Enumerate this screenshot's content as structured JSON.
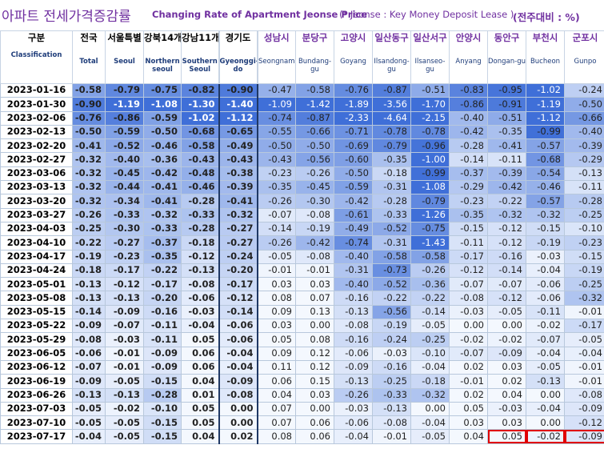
{
  "title": {
    "korean": "아파트 전세가격증감률",
    "english": "Changing Rate of Apartment Jeonse Price",
    "note": "(* Jeonse : Key Money Deposit Lease )",
    "unit": "(전주대비 : %)"
  },
  "columns": [
    {
      "kr": "구분",
      "en": "Classification"
    },
    {
      "kr": "전국",
      "en": "Total"
    },
    {
      "kr": "서울특별",
      "en": "Seoul"
    },
    {
      "kr": "강북14개",
      "en": "Northern seoul"
    },
    {
      "kr": "강남11개",
      "en": "Southern Seoul"
    },
    {
      "kr": "경기도",
      "en": "Gyeonggi-do"
    },
    {
      "kr": "성남시",
      "en": "Seongnam"
    },
    {
      "kr": "분당구",
      "en": "Bundang-gu"
    },
    {
      "kr": "고양시",
      "en": "Goyang"
    },
    {
      "kr": "일산동구",
      "en": "Ilsandong-gu"
    },
    {
      "kr": "일산서구",
      "en": "Ilsanseo-gu"
    },
    {
      "kr": "안양시",
      "en": "Anyang"
    },
    {
      "kr": "동안구",
      "en": "Dongan-gu"
    },
    {
      "kr": "부천시",
      "en": "Bucheon"
    },
    {
      "kr": "군포시",
      "en": "Gunpo"
    }
  ],
  "rows": [
    {
      "date": "2023-01-16",
      "values": [
        "-0.58",
        "-0.79",
        "-0.75",
        "-0.82",
        "-0.90",
        "-0.47",
        "-0.58",
        "-0.76",
        "-0.87",
        "-0.51",
        "-0.83",
        "-0.95",
        "-1.02",
        "-0.24"
      ]
    },
    {
      "date": "2023-01-30",
      "values": [
        "-0.90",
        "-1.19",
        "-1.08",
        "-1.30",
        "-1.40",
        "-1.09",
        "-1.42",
        "-1.89",
        "-3.56",
        "-1.70",
        "-0.86",
        "-0.91",
        "-1.19",
        "-0.50"
      ]
    },
    {
      "date": "2023-02-06",
      "values": [
        "-0.76",
        "-0.86",
        "-0.59",
        "-1.02",
        "-1.12",
        "-0.74",
        "-0.87",
        "-2.33",
        "-4.64",
        "-2.15",
        "-0.40",
        "-0.51",
        "-1.12",
        "-0.66"
      ]
    },
    {
      "date": "2023-02-13",
      "values": [
        "-0.50",
        "-0.59",
        "-0.50",
        "-0.68",
        "-0.65",
        "-0.55",
        "-0.66",
        "-0.71",
        "-0.78",
        "-0.78",
        "-0.42",
        "-0.35",
        "-0.99",
        "-0.40"
      ]
    },
    {
      "date": "2023-02-20",
      "values": [
        "-0.41",
        "-0.52",
        "-0.46",
        "-0.58",
        "-0.49",
        "-0.50",
        "-0.50",
        "-0.69",
        "-0.79",
        "-0.96",
        "-0.28",
        "-0.41",
        "-0.57",
        "-0.39"
      ]
    },
    {
      "date": "2023-02-27",
      "values": [
        "-0.32",
        "-0.40",
        "-0.36",
        "-0.43",
        "-0.43",
        "-0.43",
        "-0.56",
        "-0.60",
        "-0.35",
        "-1.00",
        "-0.14",
        "-0.11",
        "-0.68",
        "-0.29"
      ]
    },
    {
      "date": "2023-03-06",
      "values": [
        "-0.32",
        "-0.45",
        "-0.42",
        "-0.48",
        "-0.38",
        "-0.23",
        "-0.26",
        "-0.50",
        "-0.18",
        "-0.99",
        "-0.37",
        "-0.39",
        "-0.54",
        "-0.13"
      ]
    },
    {
      "date": "2023-03-13",
      "values": [
        "-0.32",
        "-0.44",
        "-0.41",
        "-0.46",
        "-0.39",
        "-0.35",
        "-0.45",
        "-0.59",
        "-0.31",
        "-1.08",
        "-0.29",
        "-0.42",
        "-0.46",
        "-0.11"
      ]
    },
    {
      "date": "2023-03-20",
      "values": [
        "-0.32",
        "-0.34",
        "-0.41",
        "-0.28",
        "-0.41",
        "-0.26",
        "-0.30",
        "-0.42",
        "-0.28",
        "-0.79",
        "-0.23",
        "-0.22",
        "-0.57",
        "-0.28"
      ]
    },
    {
      "date": "2023-03-27",
      "values": [
        "-0.26",
        "-0.33",
        "-0.32",
        "-0.33",
        "-0.32",
        "-0.07",
        "-0.08",
        "-0.61",
        "-0.33",
        "-1.26",
        "-0.35",
        "-0.32",
        "-0.32",
        "-0.25"
      ]
    },
    {
      "date": "2023-04-03",
      "values": [
        "-0.25",
        "-0.30",
        "-0.33",
        "-0.28",
        "-0.27",
        "-0.14",
        "-0.19",
        "-0.49",
        "-0.52",
        "-0.75",
        "-0.15",
        "-0.12",
        "-0.15",
        "-0.10"
      ]
    },
    {
      "date": "2023-04-10",
      "values": [
        "-0.22",
        "-0.27",
        "-0.37",
        "-0.18",
        "-0.27",
        "-0.26",
        "-0.42",
        "-0.74",
        "-0.31",
        "-1.43",
        "-0.11",
        "-0.12",
        "-0.19",
        "-0.23"
      ]
    },
    {
      "date": "2023-04-17",
      "values": [
        "-0.19",
        "-0.23",
        "-0.35",
        "-0.12",
        "-0.24",
        "-0.05",
        "-0.08",
        "-0.40",
        "-0.58",
        "-0.58",
        "-0.17",
        "-0.16",
        "-0.03",
        "-0.15"
      ]
    },
    {
      "date": "2023-04-24",
      "values": [
        "-0.18",
        "-0.17",
        "-0.22",
        "-0.13",
        "-0.20",
        "-0.01",
        "-0.01",
        "-0.31",
        "-0.73",
        "-0.26",
        "-0.12",
        "-0.14",
        "-0.04",
        "-0.19"
      ]
    },
    {
      "date": "2023-05-01",
      "values": [
        "-0.13",
        "-0.12",
        "-0.17",
        "-0.08",
        "-0.17",
        "0.03",
        "0.03",
        "-0.40",
        "-0.52",
        "-0.36",
        "-0.07",
        "-0.07",
        "-0.06",
        "-0.25"
      ]
    },
    {
      "date": "2023-05-08",
      "values": [
        "-0.13",
        "-0.13",
        "-0.20",
        "-0.06",
        "-0.12",
        "0.08",
        "0.07",
        "-0.16",
        "-0.22",
        "-0.22",
        "-0.08",
        "-0.12",
        "-0.06",
        "-0.32"
      ]
    },
    {
      "date": "2023-05-15",
      "values": [
        "-0.14",
        "-0.09",
        "-0.16",
        "-0.03",
        "-0.14",
        "0.09",
        "0.13",
        "-0.13",
        "-0.56",
        "-0.14",
        "-0.03",
        "-0.05",
        "-0.11",
        "-0.01"
      ]
    },
    {
      "date": "2023-05-22",
      "values": [
        "-0.09",
        "-0.07",
        "-0.11",
        "-0.04",
        "-0.06",
        "0.03",
        "0.00",
        "-0.08",
        "-0.19",
        "-0.05",
        "0.00",
        "0.00",
        "-0.02",
        "-0.17"
      ]
    },
    {
      "date": "2023-05-29",
      "values": [
        "-0.08",
        "-0.03",
        "-0.11",
        "0.05",
        "-0.06",
        "0.05",
        "0.08",
        "-0.16",
        "-0.24",
        "-0.25",
        "-0.02",
        "-0.02",
        "-0.07",
        "-0.05"
      ]
    },
    {
      "date": "2023-06-05",
      "values": [
        "-0.06",
        "-0.01",
        "-0.09",
        "0.06",
        "-0.04",
        "0.09",
        "0.12",
        "-0.06",
        "-0.03",
        "-0.10",
        "-0.07",
        "-0.09",
        "-0.04",
        "-0.04"
      ]
    },
    {
      "date": "2023-06-12",
      "values": [
        "-0.07",
        "-0.01",
        "-0.09",
        "0.06",
        "-0.04",
        "0.11",
        "0.12",
        "-0.09",
        "-0.16",
        "-0.04",
        "0.02",
        "0.03",
        "-0.05",
        "-0.01"
      ]
    },
    {
      "date": "2023-06-19",
      "values": [
        "-0.09",
        "-0.05",
        "-0.15",
        "0.04",
        "-0.09",
        "0.06",
        "0.15",
        "-0.13",
        "-0.25",
        "-0.18",
        "-0.01",
        "0.02",
        "-0.13",
        "-0.01"
      ]
    },
    {
      "date": "2023-06-26",
      "values": [
        "-0.13",
        "-0.13",
        "-0.28",
        "0.01",
        "-0.08",
        "0.04",
        "0.03",
        "-0.26",
        "-0.33",
        "-0.32",
        "0.02",
        "0.04",
        "0.00",
        "-0.08"
      ]
    },
    {
      "date": "2023-07-03",
      "values": [
        "-0.05",
        "-0.02",
        "-0.10",
        "0.05",
        "0.00",
        "0.07",
        "0.00",
        "-0.03",
        "-0.13",
        "0.00",
        "0.05",
        "-0.03",
        "-0.04",
        "-0.09"
      ]
    },
    {
      "date": "2023-07-10",
      "values": [
        "-0.05",
        "-0.05",
        "-0.15",
        "0.05",
        "0.00",
        "0.07",
        "0.06",
        "-0.06",
        "-0.08",
        "-0.04",
        "0.03",
        "0.03",
        "0.00",
        "-0.12"
      ]
    },
    {
      "date": "2023-07-17",
      "values": [
        "-0.04",
        "-0.05",
        "-0.15",
        "0.04",
        "0.02",
        "0.08",
        "0.06",
        "-0.04",
        "-0.01",
        "-0.05",
        "0.04",
        "0.05",
        "-0.02",
        "-0.09"
      ]
    }
  ],
  "highlighted_cells": [
    {
      "date": "2023-07-17",
      "column": "Dongan-gu"
    },
    {
      "date": "2023-07-17",
      "column": "Bucheon"
    },
    {
      "date": "2023-07-17",
      "column": "Gunpo"
    }
  ],
  "colors": {
    "title": "#7030a0",
    "cell_darkest": "#3f6fd8",
    "cell_lightest": "#f4f8fe",
    "separator": "#1f3864",
    "highlight_box": "#e00000"
  }
}
